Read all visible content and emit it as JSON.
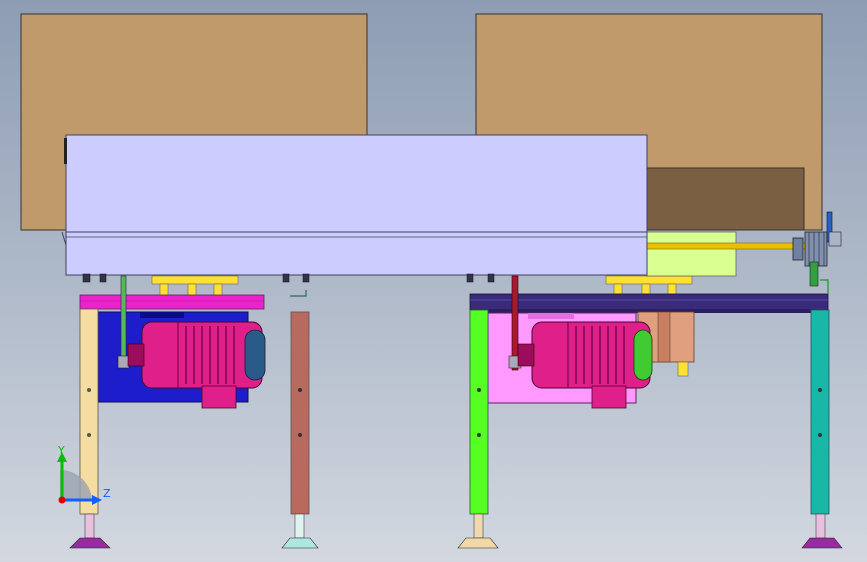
{
  "triad": {
    "y_label": "Y",
    "z_label": "Z",
    "y_color": "#00c000",
    "z_color": "#1060ff",
    "x_color": "#e00000"
  },
  "colors": {
    "box": "#c09a6b",
    "box_shadow": "#7a5f42",
    "cover": "#ccccff",
    "cover_edge": "#404060",
    "blue_plate": "#1d1dcc",
    "pink_plate": "#ff99ff",
    "motor": "#e0208a",
    "motor_dark": "#9c0c5c",
    "magenta_bar": "#ee22cc",
    "purple_beam": "#3a2a7a",
    "leg_tan": "#f5dca0",
    "leg_brown": "#b86a5e",
    "leg_green": "#55ff22",
    "leg_teal": "#18b8a8",
    "yellow": "#ffe033",
    "lime": "#d8ff90",
    "shaft": "#e8c000",
    "foot": "#9a2aa0",
    "copper": "#e0a080"
  }
}
